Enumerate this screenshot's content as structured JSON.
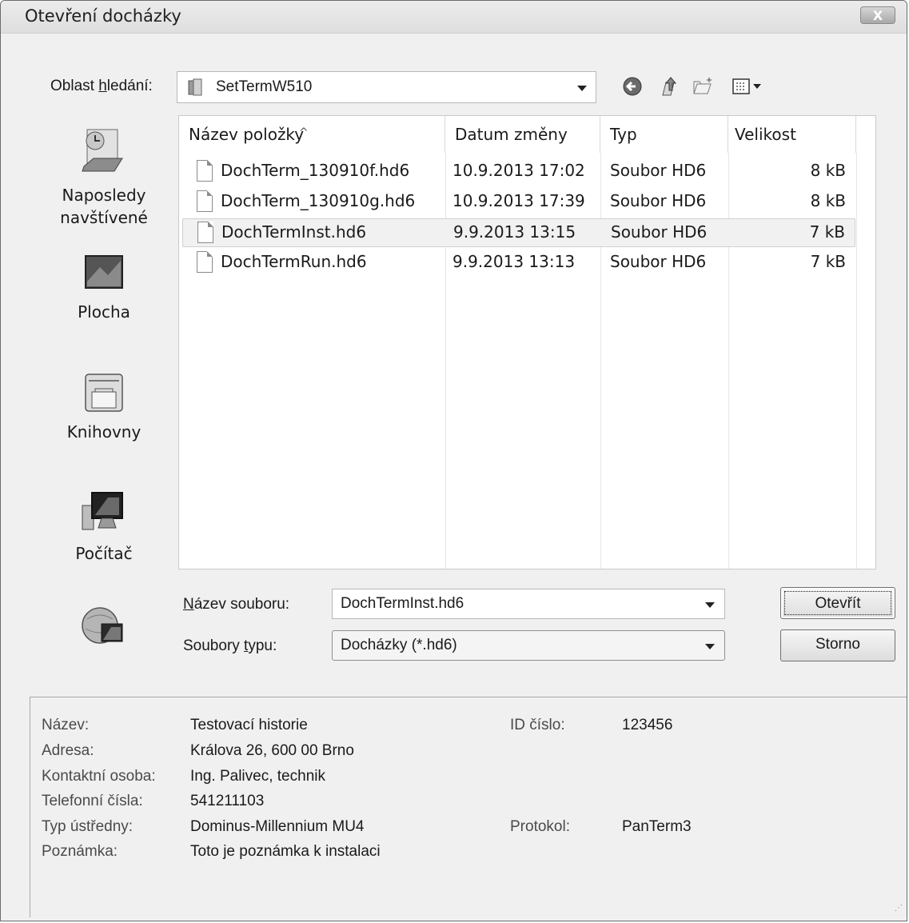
{
  "window": {
    "title": "Otevření docházky",
    "close_glyph": "X"
  },
  "lookin": {
    "label_pre": "Oblast ",
    "label_u": "h",
    "label_post": "ledání:",
    "folder": "SetTermW510",
    "folder_icon": "folder-icon"
  },
  "toolbar": {
    "back_icon": "back-arrow-icon",
    "up_icon": "up-folder-icon",
    "new_folder_icon": "new-folder-icon",
    "views_icon": "views-menu-icon"
  },
  "places": [
    {
      "label_line1": "Naposledy",
      "label_line2": "navštívené",
      "icon": "recent-places-icon"
    },
    {
      "label_line1": "Plocha",
      "label_line2": "",
      "icon": "desktop-icon"
    },
    {
      "label_line1": "Knihovny",
      "label_line2": "",
      "icon": "libraries-icon"
    },
    {
      "label_line1": "Počítač",
      "label_line2": "",
      "icon": "computer-icon"
    },
    {
      "label_line1": "",
      "label_line2": "",
      "icon": "network-icon"
    }
  ],
  "columns": {
    "name": "Název položky",
    "date": "Datum změny",
    "type": "Typ",
    "size": "Velikost"
  },
  "files": [
    {
      "name": "DochTerm_130910f.hd6",
      "date": "10.9.2013 17:02",
      "type": "Soubor HD6",
      "size": "8 kB",
      "selected": false
    },
    {
      "name": "DochTerm_130910g.hd6",
      "date": "10.9.2013 17:39",
      "type": "Soubor HD6",
      "size": "8 kB",
      "selected": false
    },
    {
      "name": "DochTermInst.hd6",
      "date": "9.9.2013 13:15",
      "type": "Soubor HD6",
      "size": "7 kB",
      "selected": true
    },
    {
      "name": "DochTermRun.hd6",
      "date": "9.9.2013 13:13",
      "type": "Soubor HD6",
      "size": "7 kB",
      "selected": false
    }
  ],
  "filename": {
    "label_u": "N",
    "label_post": "ázev souboru:",
    "value": "DochTermInst.hd6"
  },
  "filetype": {
    "label_pre": "Soubory ",
    "label_u": "t",
    "label_post": "ypu:",
    "value": "Docházky (*.hd6)"
  },
  "buttons": {
    "open": "Otevřít",
    "cancel": "Storno"
  },
  "info": {
    "name_label": "Název:",
    "name_value": "Testovací historie",
    "address_label": "Adresa:",
    "address_value": "Králova 26, 600 00 Brno",
    "contact_label": "Kontaktní osoba:",
    "contact_value": "Ing. Palivec, technik",
    "phone_label": "Telefonní čísla:",
    "phone_value": "541211103",
    "central_label": "Typ ústředny:",
    "central_value": "Dominus-Millennium MU4",
    "note_label": "Poznámka:",
    "note_value": "Toto je poznámka k instalaci",
    "id_label": "ID číslo:",
    "id_value": "123456",
    "protocol_label": "Protokol:",
    "protocol_value": "PanTerm3"
  }
}
